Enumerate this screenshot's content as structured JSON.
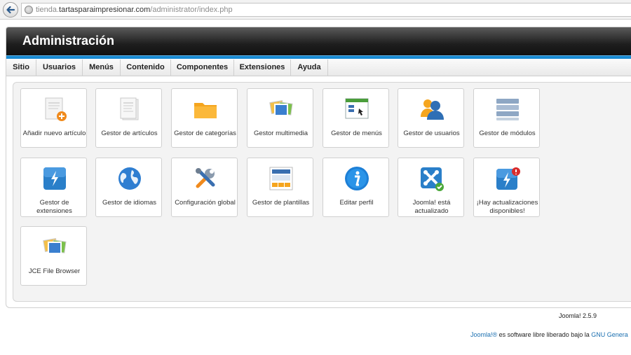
{
  "browser": {
    "url_prefix": "tienda.",
    "url_domain": "tartasparaimpresionar.com",
    "url_path": "/administrator/index.php"
  },
  "header": {
    "title": "Administración"
  },
  "menu": [
    "Sitio",
    "Usuarios",
    "Menús",
    "Contenido",
    "Componentes",
    "Extensiones",
    "Ayuda"
  ],
  "tiles": [
    {
      "label": "Añadir nuevo artículo",
      "icon": "add-article-icon"
    },
    {
      "label": "Gestor de artículos",
      "icon": "article-manager-icon"
    },
    {
      "label": "Gestor de categorías",
      "icon": "folder-icon"
    },
    {
      "label": "Gestor multimedia",
      "icon": "media-icon"
    },
    {
      "label": "Gestor de menús",
      "icon": "menu-manager-icon"
    },
    {
      "label": "Gestor de usuarios",
      "icon": "users-icon"
    },
    {
      "label": "Gestor de módulos",
      "icon": "modules-icon"
    },
    {
      "label": "Gestor de extensiones",
      "icon": "extensions-icon"
    },
    {
      "label": "Gestor de idiomas",
      "icon": "globe-icon"
    },
    {
      "label": "Configuración global",
      "icon": "tools-icon"
    },
    {
      "label": "Gestor de plantillas",
      "icon": "templates-icon"
    },
    {
      "label": "Editar perfil",
      "icon": "info-icon"
    },
    {
      "label": "Joomla! está actualizado",
      "icon": "joomla-check-icon"
    },
    {
      "label": "¡Hay actualizaciones disponibles!",
      "icon": "update-alert-icon"
    },
    {
      "label": "JCE File Browser",
      "icon": "file-browser-icon"
    }
  ],
  "footer": {
    "version": "Joomla! 2.5.9",
    "license_link": "Joomla!®",
    "license_text": " es software libre liberado bajo la ",
    "license_gpl": "GNU Genera"
  },
  "colors": {
    "header_dark": "#1e1e1e",
    "accent_blue": "#1a8ad1",
    "link": "#1a6fb0"
  }
}
